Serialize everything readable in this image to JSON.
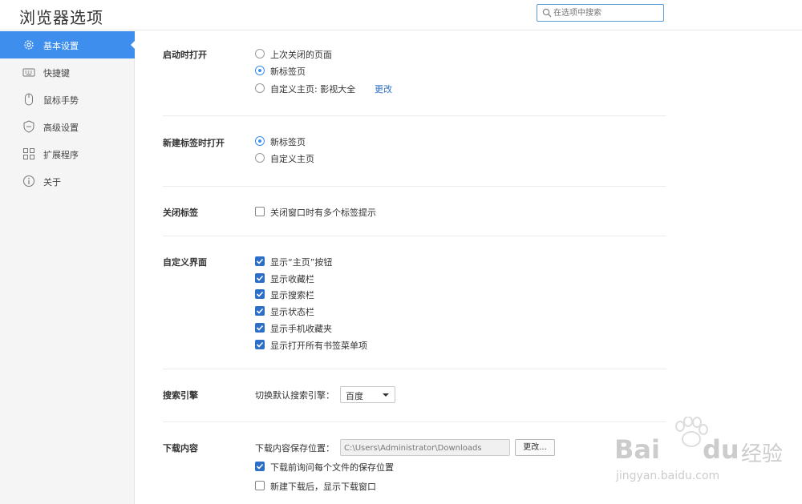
{
  "app": {
    "title": "浏览器选项"
  },
  "search": {
    "placeholder": "在选项中搜索"
  },
  "sidebar": {
    "items": [
      {
        "label": "基本设置",
        "icon": "gear-icon",
        "active": true
      },
      {
        "label": "快捷键",
        "icon": "keyboard-icon"
      },
      {
        "label": "鼠标手势",
        "icon": "mouse-icon"
      },
      {
        "label": "高级设置",
        "icon": "shield-icon"
      },
      {
        "label": "扩展程序",
        "icon": "grid-icon"
      },
      {
        "label": "关于",
        "icon": "info-icon"
      }
    ]
  },
  "startup": {
    "label": "启动时打开",
    "options": [
      "上次关闭的页面",
      "新标签页",
      "自定义主页: 影视大全"
    ],
    "selected_index": 1,
    "change_link": "更改"
  },
  "new_tab": {
    "label": "新建标签时打开",
    "options": [
      "新标签页",
      "自定义主页"
    ],
    "selected_index": 0
  },
  "close_tab": {
    "label": "关闭标签",
    "option": "关闭窗口时有多个标签提示",
    "checked": false
  },
  "custom_ui": {
    "label": "自定义界面",
    "options": [
      "显示“主页”按钮",
      "显示收藏栏",
      "显示搜索栏",
      "显示状态栏",
      "显示手机收藏夹",
      "显示打开所有书签菜单项"
    ],
    "checked": [
      true,
      true,
      true,
      true,
      true,
      true
    ]
  },
  "search_engine": {
    "label": "搜索引擎",
    "prompt": "切换默认搜索引擎：",
    "selected": "百度"
  },
  "downloads": {
    "label": "下载内容",
    "location_label": "下载内容保存位置：",
    "path": "C:\\Users\\Administrator\\Downloads",
    "change_button": "更改...",
    "options": [
      "下载前询问每个文件的保存位置",
      "新建下载后，显示下载窗口"
    ],
    "checked": [
      true,
      false
    ]
  },
  "watermark": {
    "brand": "Bai",
    "brand2": "du",
    "cn": "经验",
    "url": "jingyan.baidu.com"
  },
  "colors": {
    "accent": "#3d8eed",
    "checkbox": "#2b6fc6",
    "sidebar_bg": "#f5f5f5"
  }
}
